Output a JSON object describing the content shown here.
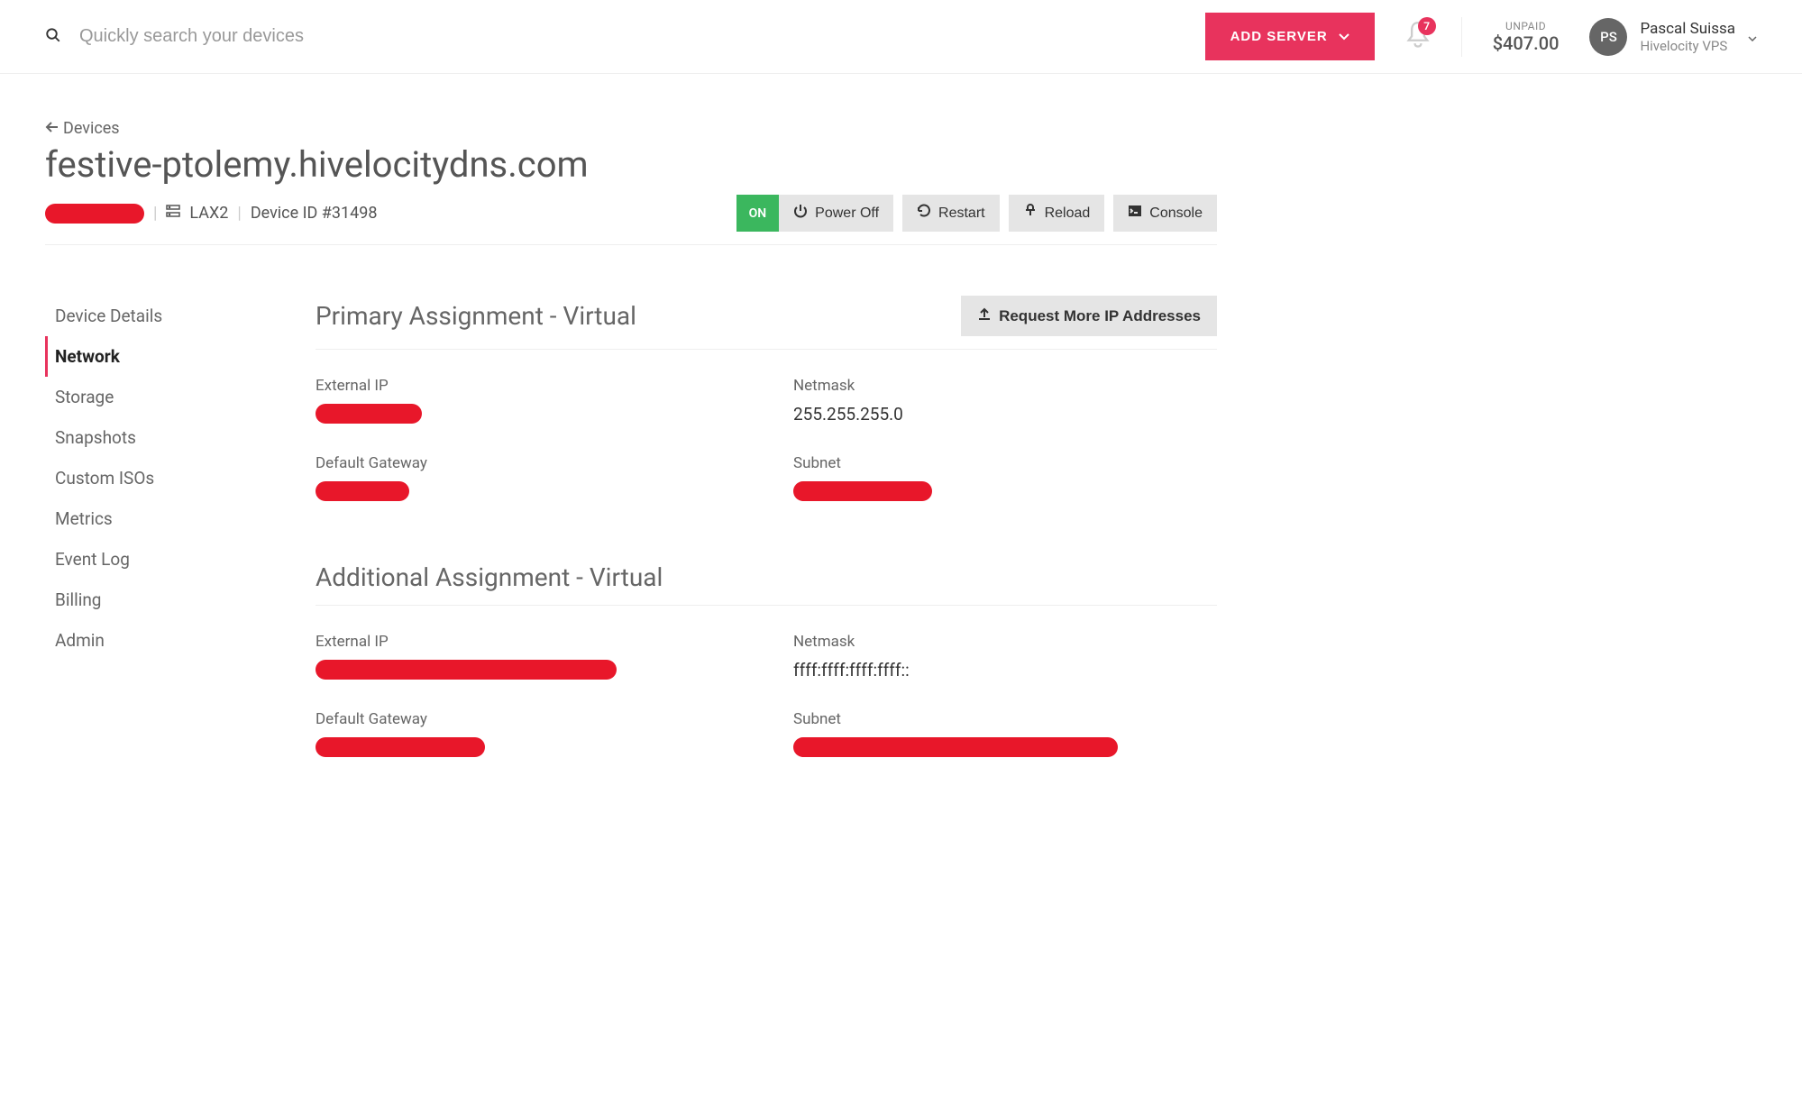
{
  "header": {
    "search_placeholder": "Quickly search your devices",
    "add_server_label": "ADD SERVER",
    "notification_count": "7",
    "unpaid_label": "UNPAID",
    "unpaid_amount": "$407.00",
    "avatar_initials": "PS",
    "user_name": "Pascal Suissa",
    "user_org": "Hivelocity VPS"
  },
  "breadcrumb": {
    "back_label": "Devices"
  },
  "device": {
    "hostname": "festive-ptolemy.hivelocitydns.com",
    "datacenter": "LAX2",
    "device_id": "Device ID #31498",
    "status": "ON"
  },
  "actions": {
    "power_off": "Power Off",
    "restart": "Restart",
    "reload": "Reload",
    "console": "Console"
  },
  "sidebar": {
    "items": [
      {
        "label": "Device Details",
        "active": false
      },
      {
        "label": "Network",
        "active": true
      },
      {
        "label": "Storage",
        "active": false
      },
      {
        "label": "Snapshots",
        "active": false
      },
      {
        "label": "Custom ISOs",
        "active": false
      },
      {
        "label": "Metrics",
        "active": false
      },
      {
        "label": "Event Log",
        "active": false
      },
      {
        "label": "Billing",
        "active": false
      },
      {
        "label": "Admin",
        "active": false
      }
    ]
  },
  "panel": {
    "request_ip_label": "Request More IP Addresses",
    "sections": [
      {
        "title": "Primary Assignment - Virtual",
        "fields": {
          "external_ip_label": "External IP",
          "external_ip_value": "[redacted]",
          "netmask_label": "Netmask",
          "netmask_value": "255.255.255.0",
          "gateway_label": "Default Gateway",
          "gateway_value": "[redacted]",
          "subnet_label": "Subnet",
          "subnet_value": "[redacted]"
        }
      },
      {
        "title": "Additional Assignment - Virtual",
        "fields": {
          "external_ip_label": "External IP",
          "external_ip_value": "[redacted]",
          "netmask_label": "Netmask",
          "netmask_value": "ffff:ffff:ffff:ffff::",
          "gateway_label": "Default Gateway",
          "gateway_value": "[redacted]",
          "subnet_label": "Subnet",
          "subnet_value": "[redacted]"
        }
      }
    ]
  }
}
